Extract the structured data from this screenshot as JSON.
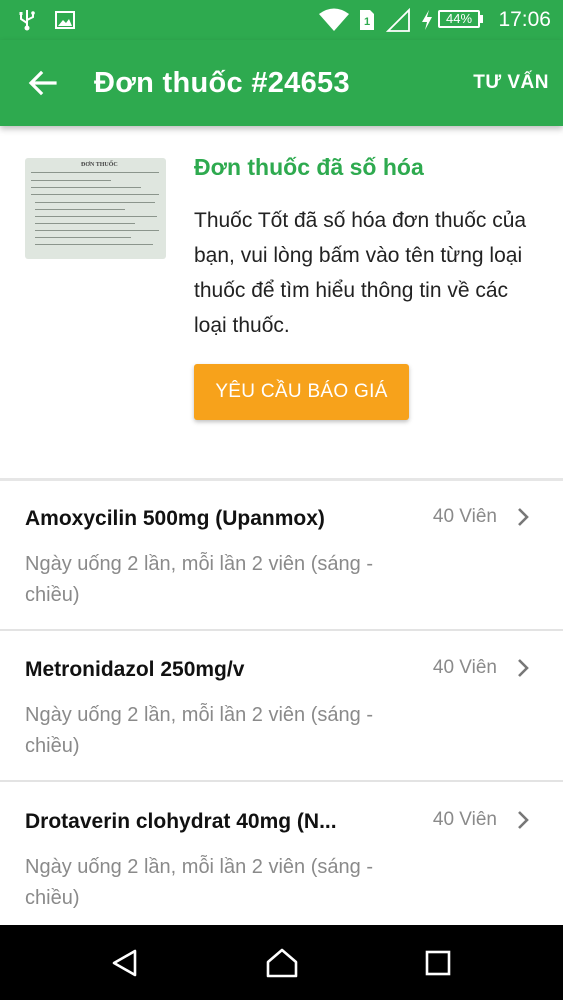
{
  "status_bar": {
    "time": "17:06",
    "battery": "44%",
    "sim_slot": "1",
    "icons": [
      "usb-icon",
      "image-icon",
      "wifi-icon",
      "sim-icon",
      "signal-icon",
      "charging-icon",
      "battery-icon"
    ]
  },
  "app_bar": {
    "title": "Đơn thuốc #24653",
    "action_label": "TƯ VẤN",
    "back_icon": "arrow-left-icon"
  },
  "header": {
    "thumbnail_title": "ĐƠN THUỐC",
    "title": "Đơn thuốc đã số hóa",
    "description": "Thuốc Tốt đã số hóa đơn thuốc của bạn, vui lòng bấm vào tên từng loại thuốc để tìm hiểu thông tin về các loại thuốc.",
    "quote_button": "YÊU CẦU BÁO GIÁ"
  },
  "medicines": [
    {
      "name": "Amoxycilin 500mg (Upanmox)",
      "quantity": "40 Viên",
      "dosage": "Ngày uống 2 lần, mỗi lần 2 viên (sáng - chiều)"
    },
    {
      "name": "Metronidazol 250mg/v",
      "quantity": "40 Viên",
      "dosage": "Ngày uống 2 lần, mỗi lần 2 viên (sáng - chiều)"
    },
    {
      "name": "Drotaverin clohydrat 40mg (N...",
      "quantity": "40 Viên",
      "dosage": "Ngày uống 2 lần, mỗi lần 2 viên (sáng - chiều)"
    }
  ],
  "colors": {
    "primary": "#2eaa4f",
    "accent": "#f7a21b",
    "secondary_text": "#8a8a8a"
  }
}
